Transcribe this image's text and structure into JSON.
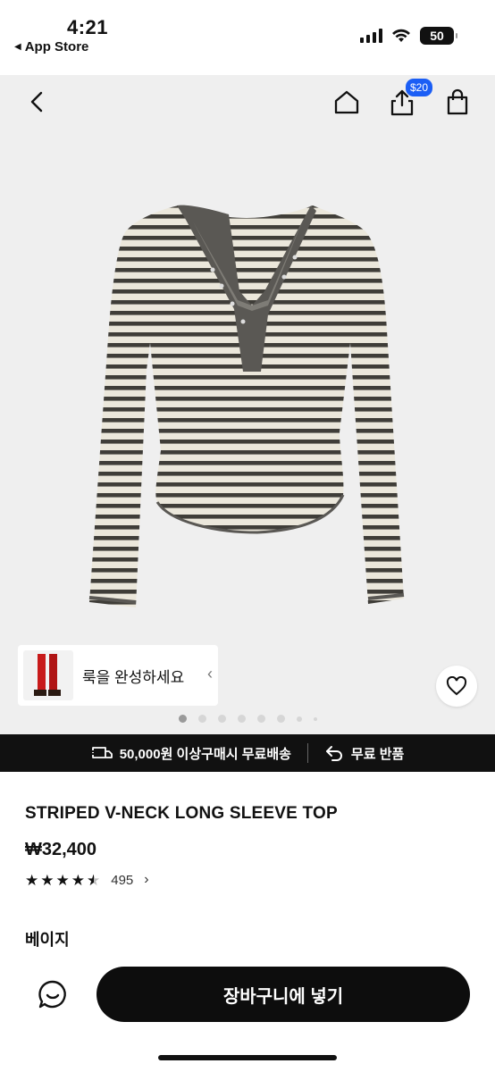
{
  "status": {
    "time": "4:21",
    "back_app": "App Store",
    "battery": "50"
  },
  "topbar": {
    "back_icon": "chevron-left-icon",
    "home_icon": "home-icon",
    "share_icon": "share-icon",
    "share_badge": "$20",
    "bag_icon": "shopping-bag-icon"
  },
  "look": {
    "label": "룩을 완성하세요"
  },
  "carousel": {
    "total": 8,
    "active": 0
  },
  "shipping": {
    "free_shipping": "50,000원 이상구매시 무료배송",
    "free_return": "무료 반품"
  },
  "product": {
    "name": "STRIPED V-NECK LONG SLEEVE TOP",
    "price": "₩32,400",
    "rating": 4.5,
    "review_count": "495",
    "color": "베이지"
  },
  "actions": {
    "add_to_cart": "장바구니에 넣기"
  },
  "colors": {
    "stripe_dark": "#3f3d38",
    "fabric_beige": "#ebe7db",
    "trim_gray": "#5a5854",
    "badge_blue": "#1b5ef5"
  }
}
